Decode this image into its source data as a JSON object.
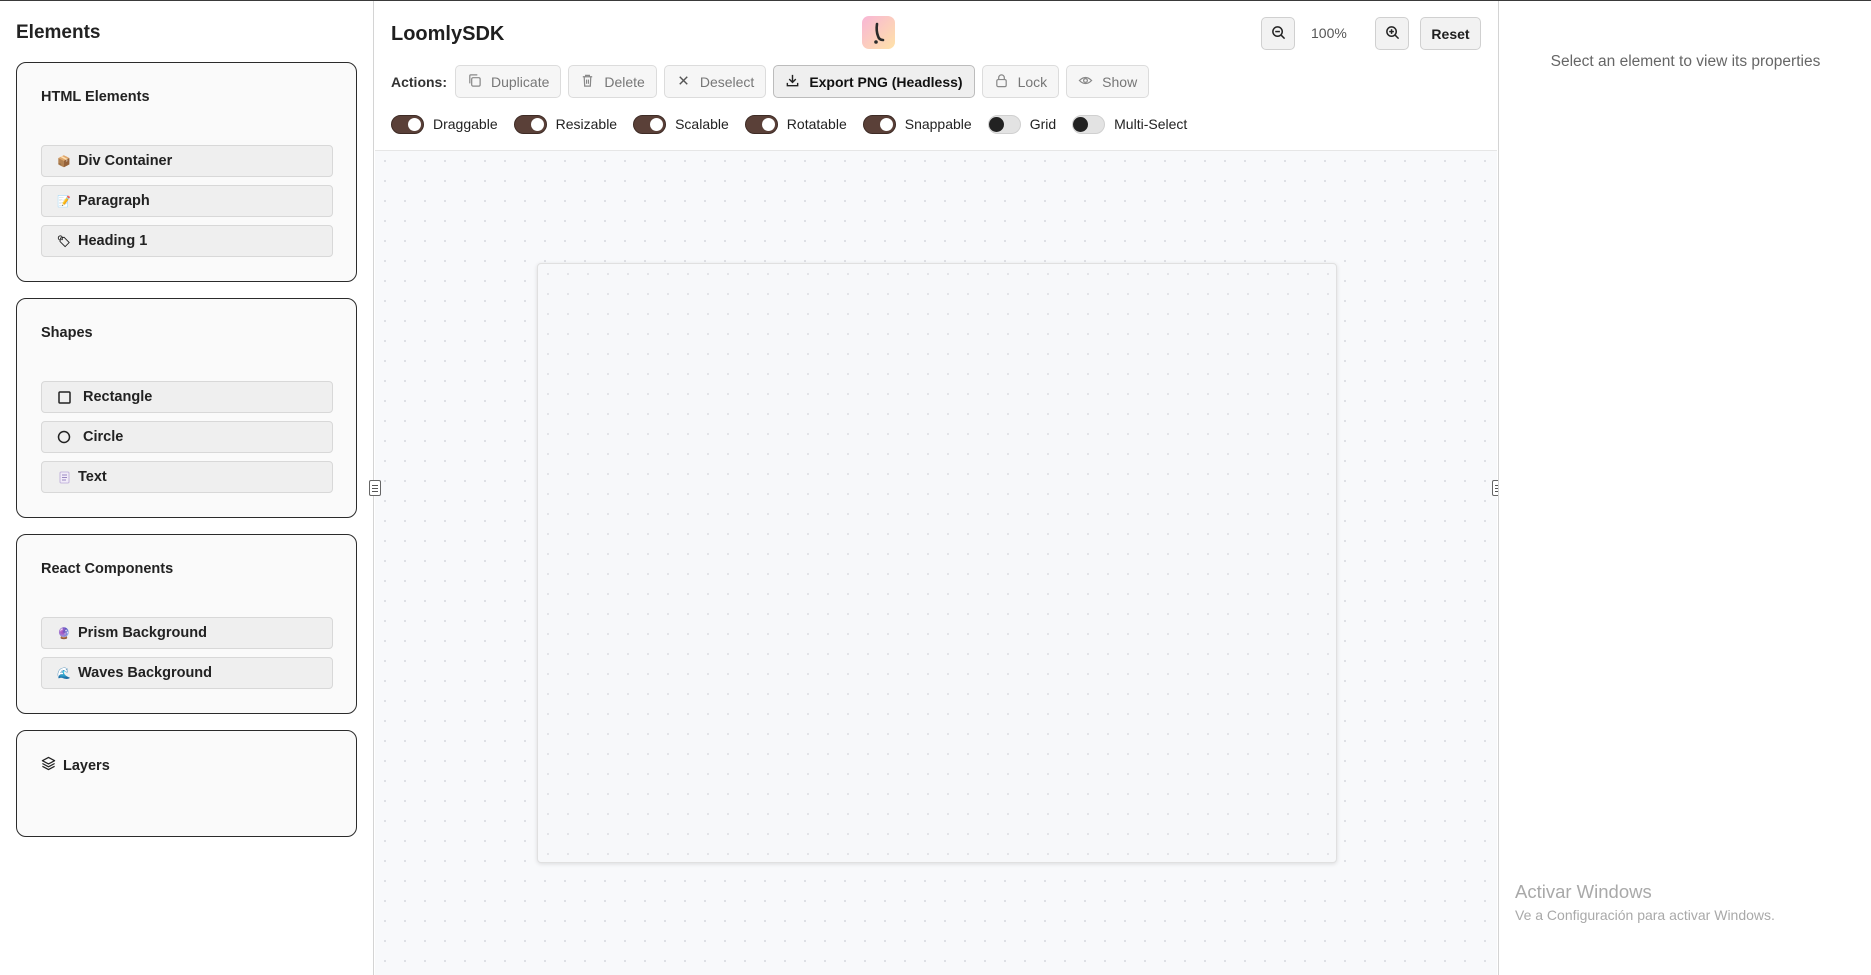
{
  "sidebar": {
    "title": "Elements",
    "html_elements": {
      "title": "HTML Elements",
      "items": [
        {
          "label": "Div Container",
          "icon": "package-icon"
        },
        {
          "label": "Paragraph",
          "icon": "memo-icon"
        },
        {
          "label": "Heading 1",
          "icon": "label-icon"
        }
      ]
    },
    "shapes": {
      "title": "Shapes",
      "items": [
        {
          "label": "Rectangle",
          "icon": "square-icon"
        },
        {
          "label": "Circle",
          "icon": "circle-icon"
        },
        {
          "label": "Text",
          "icon": "text-icon"
        }
      ]
    },
    "react_components": {
      "title": "React Components",
      "items": [
        {
          "label": "Prism Background",
          "icon": "crystal-ball-icon"
        },
        {
          "label": "Waves Background",
          "icon": "wave-icon"
        }
      ]
    },
    "layers": {
      "title": "Layers",
      "icon": "layers-icon"
    }
  },
  "header": {
    "brand": "LoomlySDK",
    "zoom_level": "100%",
    "reset_label": "Reset"
  },
  "actions": {
    "label": "Actions:",
    "buttons": [
      {
        "label": "Duplicate",
        "icon": "copy-icon"
      },
      {
        "label": "Delete",
        "icon": "trash-icon"
      },
      {
        "label": "Deselect",
        "icon": "x-icon"
      },
      {
        "label": "Export PNG (Headless)",
        "icon": "download-icon"
      },
      {
        "label": "Lock",
        "icon": "lock-icon"
      },
      {
        "label": "Show",
        "icon": "eye-icon"
      }
    ]
  },
  "toggles": [
    {
      "label": "Draggable",
      "on": true
    },
    {
      "label": "Resizable",
      "on": true
    },
    {
      "label": "Scalable",
      "on": true
    },
    {
      "label": "Rotatable",
      "on": true
    },
    {
      "label": "Snappable",
      "on": true
    },
    {
      "label": "Grid",
      "on": false
    },
    {
      "label": "Multi-Select",
      "on": false
    }
  ],
  "properties": {
    "hint": "Select an element to view its properties"
  },
  "watermark": {
    "line1": "Activar Windows",
    "line2": "Ve a Configuración para activar Windows."
  },
  "colors": {
    "toggle_on": "#5a4038",
    "canvas_bg": "#f8f9fb",
    "panel_border": "#2b2b2b"
  }
}
